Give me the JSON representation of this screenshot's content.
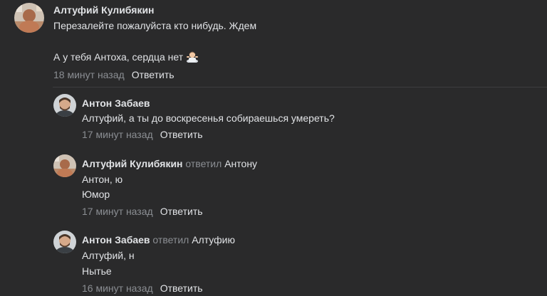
{
  "comments": [
    {
      "author": "Алтуфий Кулибякин",
      "lines": [
        "Перезалейте пожалуйста кто нибудь. Ждем",
        "А у тебя Антоха, сердца нет"
      ],
      "emoji": "man-shrugging-emoji",
      "time": "18 минут назад",
      "reply_label": "Ответить"
    },
    {
      "author": "Антон Забаев",
      "lines": [
        "Алтуфий, а ты до воскресенья собираешься умереть?"
      ],
      "time": "17 минут назад",
      "reply_label": "Ответить"
    },
    {
      "author": "Алтуфий Кулибякин",
      "replied_word": "ответил",
      "replied_to": "Антону",
      "lines": [
        "Антон, ю",
        "Юмор"
      ],
      "time": "17 минут назад",
      "reply_label": "Ответить"
    },
    {
      "author": "Антон Забаев",
      "replied_word": "ответил",
      "replied_to": "Алтуфию",
      "lines": [
        "Алтуфий, н",
        "Нытье"
      ],
      "time": "16 минут назад",
      "reply_label": "Ответить"
    }
  ],
  "colors": {
    "background": "#2a2a2b",
    "text": "#e1e3e6",
    "secondary": "#8b8e93",
    "divider": "#3d3d3f"
  }
}
